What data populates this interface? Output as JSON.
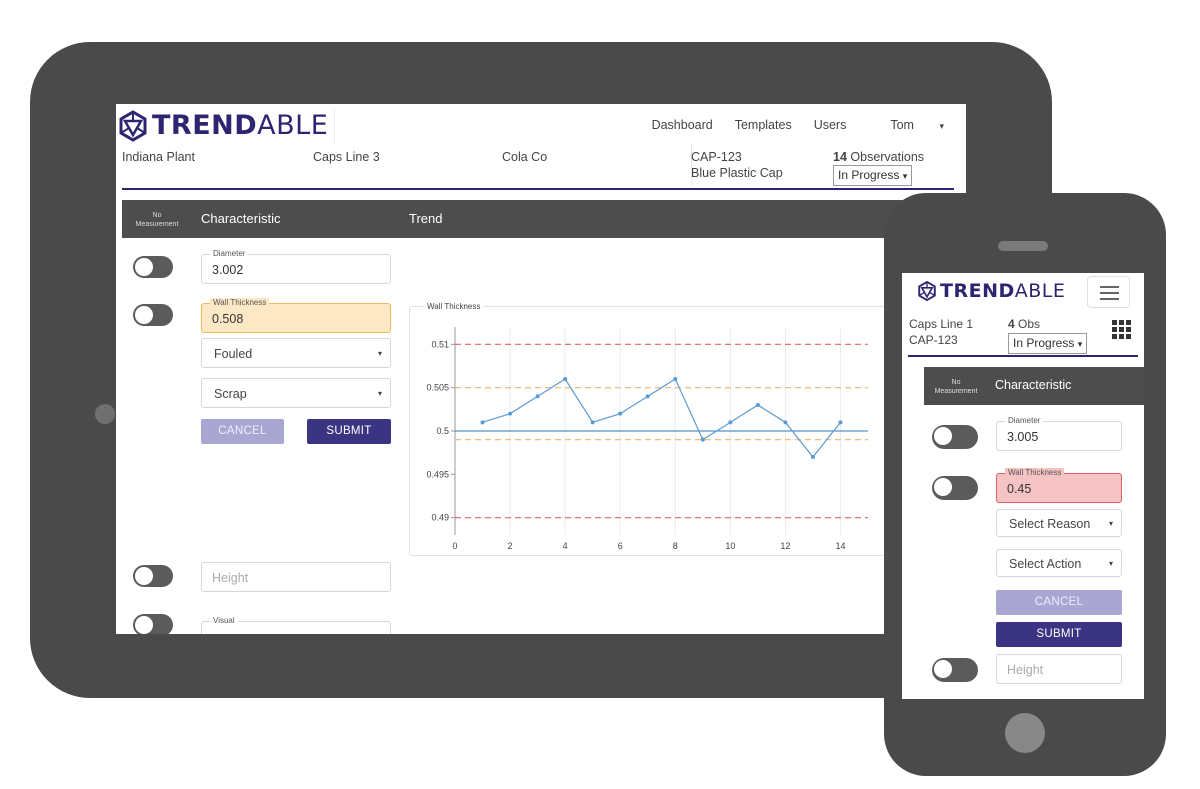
{
  "brand": {
    "logo_bold": "TREND",
    "logo_light": "ABLE"
  },
  "tablet": {
    "nav": {
      "dashboard": "Dashboard",
      "templates": "Templates",
      "users": "Users",
      "user": "Tom",
      "caret": "▾"
    },
    "info": {
      "plant": "Indiana Plant",
      "line": "Caps Line 3",
      "customer": "Cola Co",
      "part_number": "CAP-123",
      "part_name": "Blue Plastic Cap",
      "observation_count": "14",
      "observation_label": "Observations",
      "status": "In Progress",
      "status_arrow": "▾"
    },
    "table_header": {
      "no_measurement_1": "No",
      "no_measurement_2": "Measurement",
      "characteristic": "Characteristic",
      "trend": "Trend"
    },
    "rows": {
      "diameter": {
        "label": "Diameter",
        "value": "3.002"
      },
      "wall_thickness": {
        "label": "Wall Thickness",
        "value": "0.508"
      },
      "reason_select": "Fouled",
      "action_select": "Scrap",
      "select_arrow": "▾",
      "cancel": "CANCEL",
      "submit": "SUBMIT",
      "height_placeholder": "Height",
      "visual_label": "Visual"
    },
    "chart_title": "Wall Thickness"
  },
  "chart_data": {
    "type": "line",
    "title": "Wall Thickness",
    "x": [
      1,
      2,
      3,
      4,
      5,
      6,
      7,
      8,
      9,
      10,
      11,
      12,
      13,
      14
    ],
    "series": [
      {
        "values": [
          0.501,
          0.502,
          0.504,
          0.506,
          0.501,
          0.502,
          0.504,
          0.506,
          0.499,
          0.501,
          0.503,
          0.501,
          0.497,
          0.501
        ]
      }
    ],
    "center_line": 0.5,
    "control_limits": {
      "upper": 0.51,
      "lower": 0.49
    },
    "warning_limits": {
      "upper": 0.505,
      "lower": 0.499
    },
    "xlim": [
      0,
      15
    ],
    "ylim": [
      0.488,
      0.512
    ],
    "x_ticks": [
      0,
      2,
      4,
      6,
      8,
      10,
      12,
      14
    ],
    "y_ticks": [
      0.49,
      0.495,
      0.5,
      0.505,
      0.51
    ],
    "y_tick_labels": [
      "0.49",
      "0.495",
      "0.5",
      "0.505",
      "0.51"
    ],
    "grid": "vertical",
    "colors": {
      "line": "#5b9bd5",
      "center": "#2e75b6",
      "control": "#e06666",
      "warning": "#f6b26b"
    }
  },
  "phone": {
    "info": {
      "line": "Caps Line 1",
      "part_number": "CAP-123",
      "obs_count": "4",
      "obs_label": "Obs",
      "status": "In Progress",
      "status_arrow": "▾"
    },
    "table_header": {
      "no_measurement_1": "No",
      "no_measurement_2": "Measurement",
      "characteristic": "Characteristic"
    },
    "rows": {
      "diameter": {
        "label": "Diameter",
        "value": "3.005"
      },
      "wall_thickness": {
        "label": "Wall Thickness",
        "value": "0.45"
      },
      "reason_select": "Select Reason",
      "action_select": "Select Action",
      "select_arrow": "▾",
      "cancel": "CANCEL",
      "submit": "SUBMIT",
      "height_placeholder": "Height"
    }
  },
  "colors": {
    "brand": "#2d2570",
    "submit": "#3a3482",
    "cancel": "#a9a6d2",
    "warning_field": "#fde8c6",
    "error_field": "#f5c3c3",
    "device": "#4a4a4a"
  }
}
